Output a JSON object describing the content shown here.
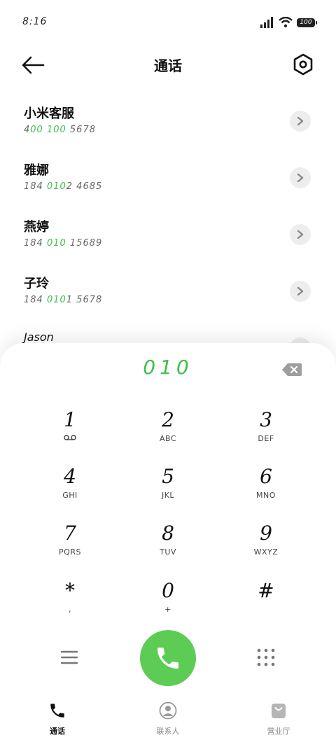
{
  "status": {
    "time": "8:16",
    "battery": "100"
  },
  "header": {
    "title": "通话"
  },
  "contacts": [
    {
      "name": "小米客服",
      "phone_prefix": "4",
      "phone_highlight": "00 100",
      "phone_suffix": " 5678"
    },
    {
      "name": "雅娜",
      "phone_prefix": "184 ",
      "phone_highlight": "010",
      "phone_suffix": "2 4685"
    },
    {
      "name": "燕婷",
      "phone_prefix": "184 ",
      "phone_highlight": "010",
      "phone_suffix": " 15689"
    },
    {
      "name": "子玲",
      "phone_prefix": "184 ",
      "phone_highlight": "010",
      "phone_suffix": "1 5678"
    },
    {
      "name": "Jason"
    }
  ],
  "dialer": {
    "input": "010",
    "keys": [
      {
        "digit": "1",
        "letters": ""
      },
      {
        "digit": "2",
        "letters": "ABC"
      },
      {
        "digit": "3",
        "letters": "DEF"
      },
      {
        "digit": "4",
        "letters": "GHI"
      },
      {
        "digit": "5",
        "letters": "JKL"
      },
      {
        "digit": "6",
        "letters": "MNO"
      },
      {
        "digit": "7",
        "letters": "PQRS"
      },
      {
        "digit": "8",
        "letters": "TUV"
      },
      {
        "digit": "9",
        "letters": "WXYZ"
      },
      {
        "digit": "*",
        "letters": ","
      },
      {
        "digit": "0",
        "letters": "+"
      },
      {
        "digit": "#",
        "letters": ""
      }
    ]
  },
  "tabs": [
    {
      "label": "通话"
    },
    {
      "label": "联系人"
    },
    {
      "label": "营业厅"
    }
  ],
  "colors": {
    "accent": "#5dcc54",
    "highlight": "#3fbf4a"
  },
  "icons": {
    "voicemail": "voicemail-icon",
    "call": "phone-icon",
    "menu": "menu-icon",
    "keypad": "dialpad-icon",
    "back": "arrow-left-icon",
    "settings": "settings-icon",
    "backspace": "backspace-icon"
  }
}
